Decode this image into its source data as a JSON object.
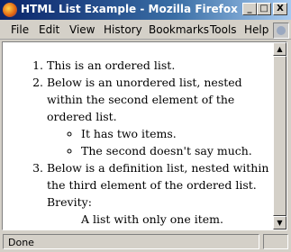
{
  "window": {
    "title": "HTML List Example - Mozilla Firefox",
    "minimize_glyph": "_",
    "maximize_glyph": "□",
    "close_glyph": "X"
  },
  "menu": {
    "file": "File",
    "edit": "Edit",
    "view": "View",
    "history": "History",
    "bookmarks": "Bookmarks",
    "tools": "Tools",
    "help": "Help"
  },
  "page": {
    "ordered_list": [
      "This is an ordered list.",
      "Below is an unordered list, nested within the second element of the ordered list.",
      "Below is a definition list, nested within the third element of the ordered list."
    ],
    "unordered_list": [
      "It has two items.",
      "The second doesn't say much."
    ],
    "definition": {
      "term": "Brevity:",
      "description": "A list with only one item."
    }
  },
  "status": {
    "text": "Done"
  },
  "icons": {
    "app": "firefox-icon",
    "throbber": "throbber-icon",
    "scroll_up": "scroll-up-icon",
    "scroll_down": "scroll-down-icon"
  }
}
